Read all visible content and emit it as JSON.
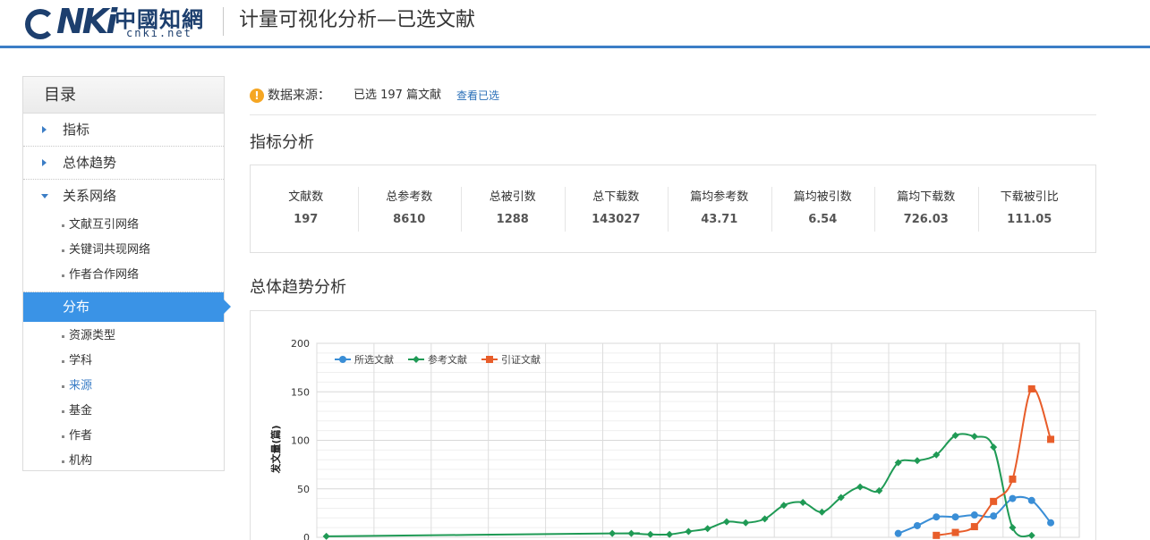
{
  "header": {
    "logo_cnki": "CNKi",
    "logo_cn": "中國知網",
    "logo_net": "cnki.net",
    "title": "计量可视化分析—已选文献"
  },
  "sidebar": {
    "title": "目录",
    "items": [
      {
        "label": "指标"
      },
      {
        "label": "总体趋势"
      },
      {
        "label": "关系网络",
        "children": [
          "文献互引网络",
          "关键词共现网络",
          "作者合作网络"
        ]
      },
      {
        "label": "分布",
        "children": [
          "资源类型",
          "学科",
          "来源",
          "基金",
          "作者",
          "机构"
        ]
      }
    ]
  },
  "source": {
    "label": "数据来源：",
    "value": "已选 197 篇文献",
    "link": "查看已选"
  },
  "metrics_section": {
    "title": "指标分析",
    "items": [
      {
        "label": "文献数",
        "value": "197"
      },
      {
        "label": "总参考数",
        "value": "8610"
      },
      {
        "label": "总被引数",
        "value": "1288"
      },
      {
        "label": "总下载数",
        "value": "143027"
      },
      {
        "label": "篇均参考数",
        "value": "43.71"
      },
      {
        "label": "篇均被引数",
        "value": "6.54"
      },
      {
        "label": "篇均下载数",
        "value": "726.03"
      },
      {
        "label": "下载被引比",
        "value": "111.05"
      }
    ]
  },
  "trend_section": {
    "title": "总体趋势分析"
  },
  "chart_data": {
    "type": "line",
    "ylabel": "发文量(篇)",
    "ylim": [
      0,
      200
    ],
    "yticks": [
      0,
      50,
      100,
      150,
      200
    ],
    "grid": true,
    "legend_placement": "top-left",
    "x_count": 40,
    "series": [
      {
        "name": "所选文献",
        "color": "#3a8ed6",
        "marker": "circle",
        "points": [
          [
            30,
            4
          ],
          [
            31,
            12
          ],
          [
            32,
            21
          ],
          [
            33,
            21
          ],
          [
            34,
            23
          ],
          [
            35,
            22
          ],
          [
            36,
            40
          ],
          [
            37,
            38
          ],
          [
            38,
            15
          ]
        ]
      },
      {
        "name": "参考文献",
        "color": "#1f9a55",
        "marker": "diamond",
        "points": [
          [
            0,
            1
          ],
          [
            15,
            4
          ],
          [
            16,
            4
          ],
          [
            17,
            3
          ],
          [
            18,
            3
          ],
          [
            19,
            6
          ],
          [
            20,
            9
          ],
          [
            21,
            16
          ],
          [
            22,
            15
          ],
          [
            23,
            19
          ],
          [
            24,
            33
          ],
          [
            25,
            36
          ],
          [
            26,
            26
          ],
          [
            27,
            41
          ],
          [
            28,
            52
          ],
          [
            29,
            48
          ],
          [
            30,
            77
          ],
          [
            31,
            79
          ],
          [
            32,
            85
          ],
          [
            33,
            105
          ],
          [
            34,
            104
          ],
          [
            35,
            93
          ],
          [
            36,
            10
          ],
          [
            37,
            2
          ]
        ]
      },
      {
        "name": "引证文献",
        "color": "#e85d2a",
        "marker": "square",
        "points": [
          [
            32,
            2
          ],
          [
            33,
            5
          ],
          [
            34,
            11
          ],
          [
            35,
            37
          ],
          [
            36,
            60
          ],
          [
            37,
            153
          ],
          [
            38,
            101
          ]
        ]
      }
    ]
  },
  "colors": {
    "accent": "#3a93e6",
    "header_border": "#3c7ec6",
    "link": "#2a6fb8",
    "warning": "#f5a623"
  }
}
